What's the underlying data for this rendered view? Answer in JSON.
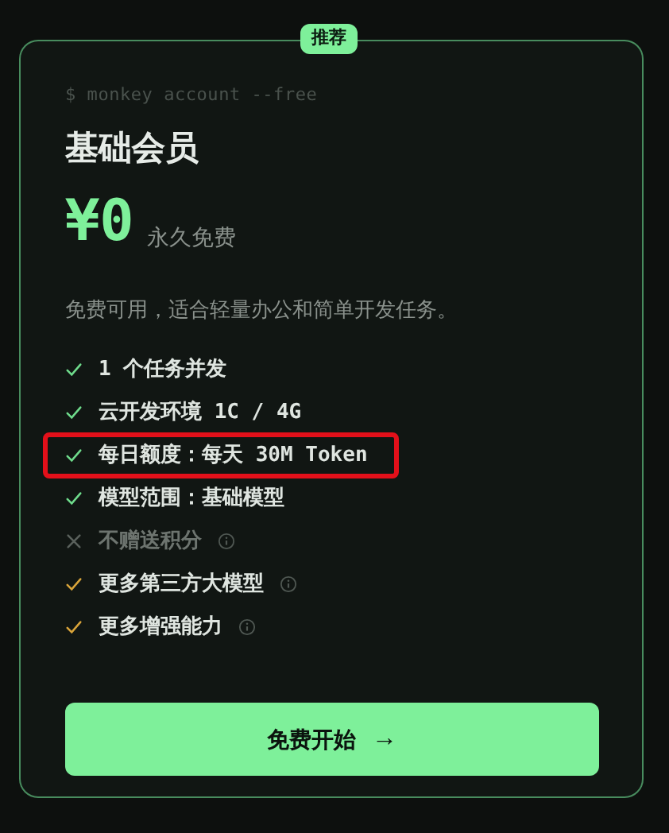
{
  "badge": "推荐",
  "command": "$ monkey account --free",
  "title": "基础会员",
  "price": {
    "amount": "¥0",
    "note": "永久免费"
  },
  "description": "免费可用，适合轻量办公和简单开发任务。",
  "features": [
    {
      "kind": "included",
      "label": "1 个任务并发",
      "info": false,
      "highlighted": false
    },
    {
      "kind": "included",
      "label": "云开发环境 1C / 4G",
      "info": false,
      "highlighted": false
    },
    {
      "kind": "included",
      "label": "每日额度：每天 30M Token",
      "info": false,
      "highlighted": true
    },
    {
      "kind": "included",
      "label": "模型范围：基础模型",
      "info": false,
      "highlighted": false
    },
    {
      "kind": "excluded",
      "label": "不赠送积分",
      "info": true,
      "highlighted": false
    },
    {
      "kind": "extra",
      "label": "更多第三方大模型",
      "info": true,
      "highlighted": false
    },
    {
      "kind": "extra",
      "label": "更多增强能力",
      "info": true,
      "highlighted": false
    }
  ],
  "button": {
    "label": "免费开始",
    "icon": "→"
  }
}
